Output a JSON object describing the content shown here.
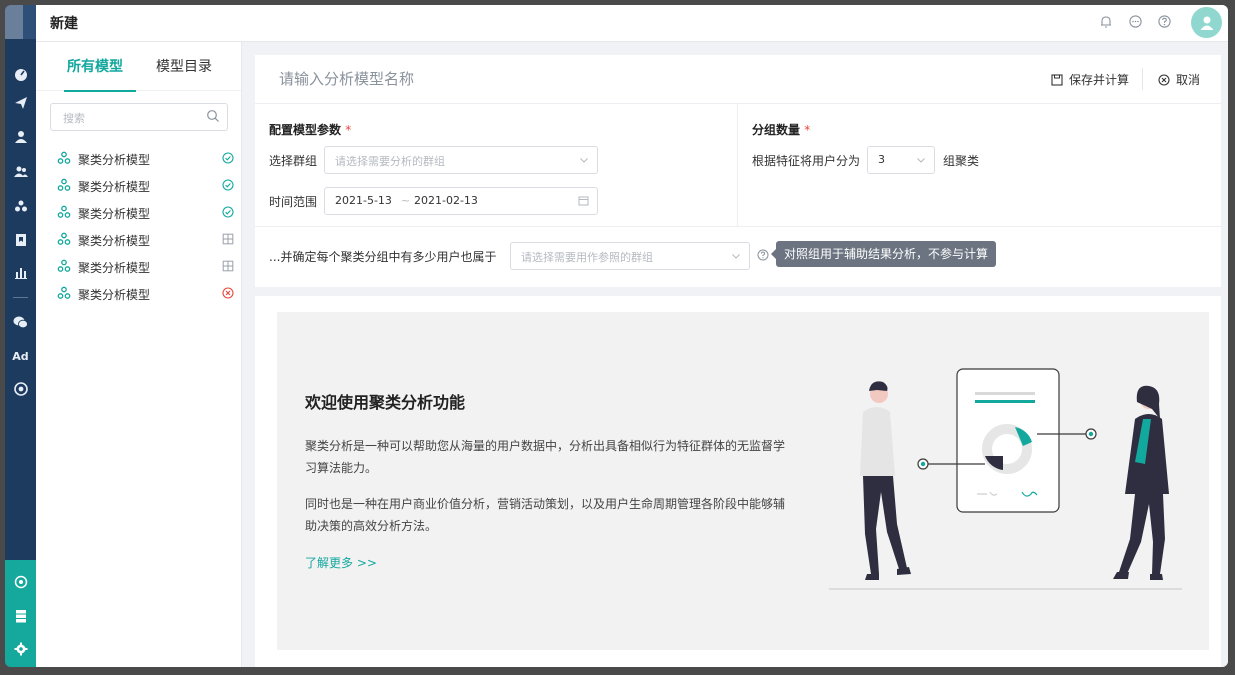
{
  "header": {
    "title": "新建"
  },
  "left_panel": {
    "tabs": [
      {
        "label": "所有模型",
        "active": true
      },
      {
        "label": "模型目录",
        "active": false
      }
    ],
    "search_placeholder": "搜索",
    "models": [
      {
        "label": "聚类分析模型",
        "status": "success"
      },
      {
        "label": "聚类分析模型",
        "status": "success"
      },
      {
        "label": "聚类分析模型",
        "status": "success"
      },
      {
        "label": "聚类分析模型",
        "status": "pending"
      },
      {
        "label": "聚类分析模型",
        "status": "pending"
      },
      {
        "label": "聚类分析模型",
        "status": "error"
      }
    ]
  },
  "form": {
    "name_placeholder": "请输入分析模型名称",
    "save_label": "保存并计算",
    "cancel_label": "取消",
    "config_title": "配置模型参数",
    "required_mark": "*",
    "group_label": "选择群组",
    "group_placeholder": "请选择需要分析的群组",
    "time_label": "时间范围",
    "time_start": "2021-5-13",
    "time_sep": "~",
    "time_end": "2021-02-13",
    "count_title": "分组数量",
    "count_prefix": "根据特征将用户分为",
    "count_value": "3",
    "count_suffix": "组聚类",
    "ref_label": "...并确定每个聚类分组中有多少用户也属于",
    "ref_placeholder": "请选择需要用作参照的群组",
    "ref_tooltip": "对照组用于辅助结果分析，不参与计算"
  },
  "welcome": {
    "title": "欢迎使用聚类分析功能",
    "paragraph1": "聚类分析是一种可以帮助您从海量的用户数据中，分析出具备相似行为特征群体的无监督学习算法能力。",
    "paragraph2": "同时也是一种在用户商业价值分析，营销活动策划，以及用户生命周期管理各阶段中能够辅助决策的高效分析方法。",
    "link": "了解更多 >>"
  },
  "colors": {
    "accent": "#13a89e",
    "rail": "#1d3a5f",
    "rail_bottom": "#15a89d",
    "error": "#e8473b"
  }
}
